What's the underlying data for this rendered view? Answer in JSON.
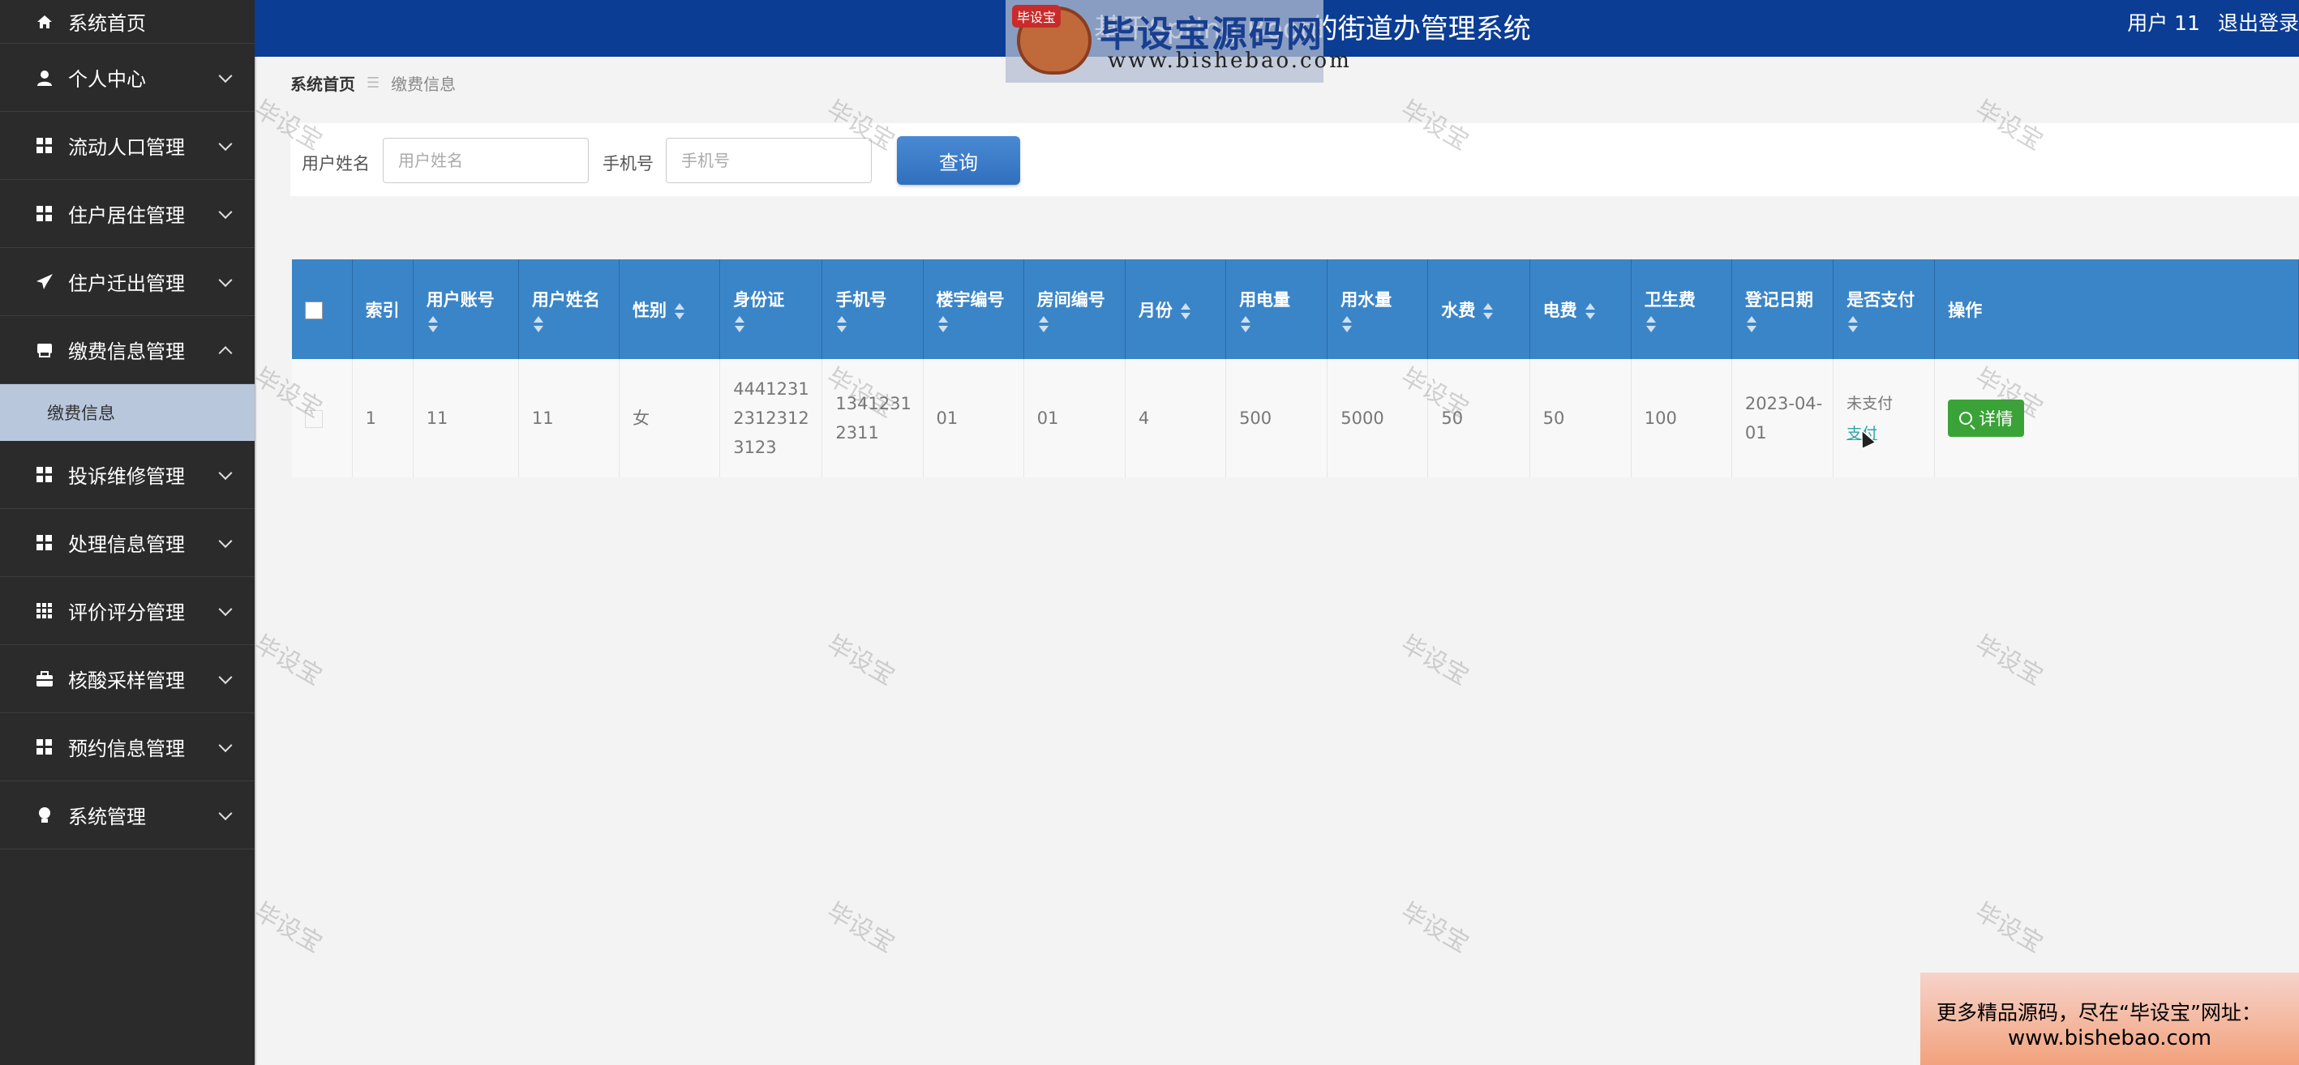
{
  "sidebar": {
    "items": [
      {
        "label": "系统首页",
        "icon": "home-icon",
        "expandable": false
      },
      {
        "label": "个人中心",
        "icon": "user-icon",
        "expandable": true
      },
      {
        "label": "流动人口管理",
        "icon": "grid-icon",
        "expandable": true
      },
      {
        "label": "住户居住管理",
        "icon": "grid-icon",
        "expandable": true
      },
      {
        "label": "住户迁出管理",
        "icon": "send-icon",
        "expandable": true
      },
      {
        "label": "缴费信息管理",
        "icon": "printer-icon",
        "expandable": true,
        "expanded": true,
        "sub": [
          "缴费信息"
        ]
      },
      {
        "label": "投诉维修管理",
        "icon": "grid-icon",
        "expandable": true
      },
      {
        "label": "处理信息管理",
        "icon": "grid-icon",
        "expandable": true
      },
      {
        "label": "评价评分管理",
        "icon": "table-icon",
        "expandable": true
      },
      {
        "label": "核酸采样管理",
        "icon": "briefcase-icon",
        "expandable": true
      },
      {
        "label": "预约信息管理",
        "icon": "grid-icon",
        "expandable": true
      },
      {
        "label": "系统管理",
        "icon": "bulb-icon",
        "expandable": true
      }
    ]
  },
  "header": {
    "title": "基于Spring Boot的街道办管理系统",
    "user": "用户 11",
    "logout": "退出登录"
  },
  "logo_overlay": {
    "badge": "毕设宝",
    "text": "毕设宝源码网",
    "url": "www.bishebao.com"
  },
  "breadcrumb": {
    "home": "系统首页",
    "current": "缴费信息"
  },
  "search": {
    "name_label": "用户姓名",
    "name_placeholder": "用户姓名",
    "phone_label": "手机号",
    "phone_placeholder": "手机号",
    "button": "查询"
  },
  "table": {
    "columns": [
      "索引",
      "用户账号",
      "用户姓名",
      "性别",
      "身份证",
      "手机号",
      "楼宇编号",
      "房间编号",
      "月份",
      "用电量",
      "用水量",
      "水费",
      "电费",
      "卫生费",
      "登记日期",
      "是否支付",
      "操作"
    ],
    "rows": [
      {
        "index": "1",
        "account": "11",
        "name": "11",
        "gender": "女",
        "id_card": "4441231 2312312 3123",
        "phone": "1341231 2311",
        "building": "01",
        "room": "01",
        "month": "4",
        "electricity_use": "500",
        "water_use": "5000",
        "water_fee": "50",
        "electric_fee": "50",
        "sanitation_fee": "100",
        "date": "2023-04-01",
        "pay_status": "未支付",
        "pay_action": "支付",
        "detail": "详情"
      }
    ]
  },
  "watermark": "毕设宝",
  "promo": {
    "line1": "更多精品源码，尽在“毕设宝”网址：",
    "line2": "www.bishebao.com"
  },
  "colors": {
    "sidebar_bg": "#2b2b2b",
    "topbar_bg": "#0b3d94",
    "table_header": "#3a85c8",
    "detail_button": "#3aa337",
    "active_sub": "#b9c7dd"
  }
}
